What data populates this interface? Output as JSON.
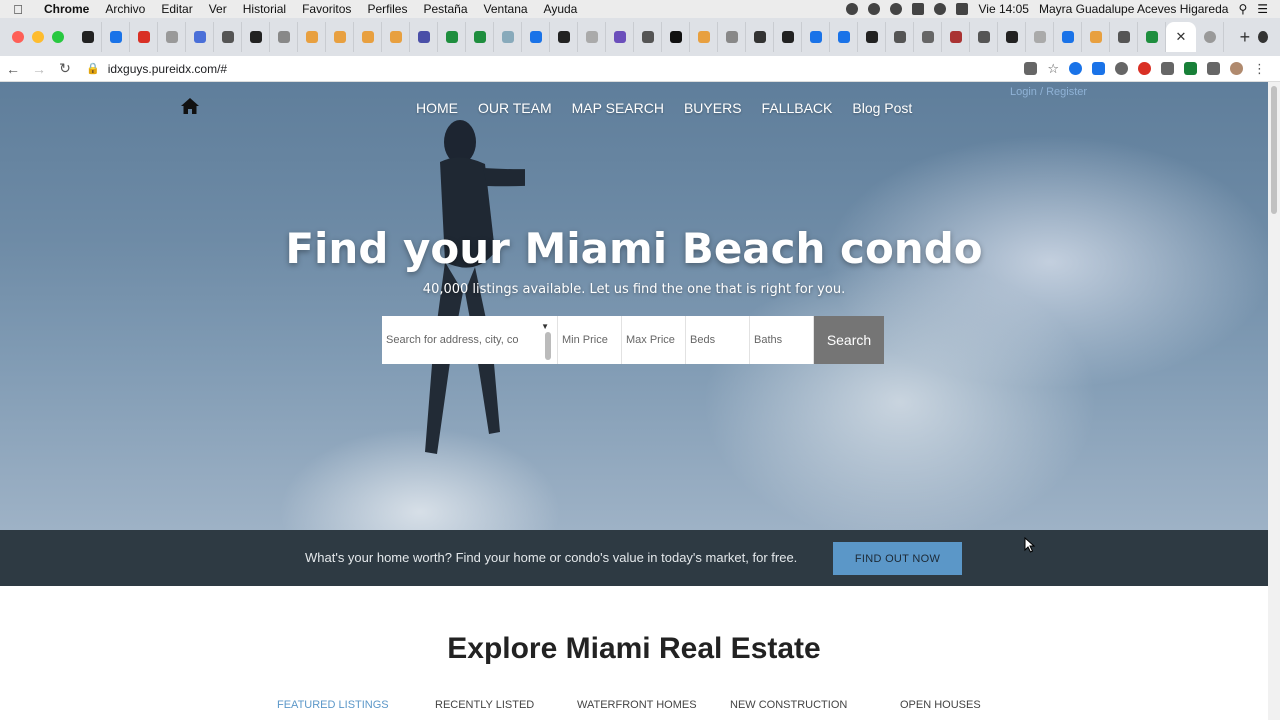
{
  "menubar": {
    "app": "Chrome",
    "items": [
      "Archivo",
      "Editar",
      "Ver",
      "Historial",
      "Favoritos",
      "Perfiles",
      "Pestaña",
      "Ventana",
      "Ayuda"
    ],
    "clock": "Vie 14:05",
    "user": "Mayra Guadalupe Aceves Higareda"
  },
  "toolbar": {
    "url": "idxguys.pureidx.com/#"
  },
  "nav": {
    "links": [
      "HOME",
      "OUR TEAM",
      "MAP SEARCH",
      "BUYERS",
      "FALLBACK",
      "Blog Post"
    ],
    "login": "Login / Register"
  },
  "hero": {
    "title": "Find your Miami Beach condo",
    "subtitle": "40,000 listings available. Let us find the one that is right for you."
  },
  "search": {
    "address_placeholder": "Search for address, city, co",
    "min_price_placeholder": "Min Price",
    "max_price_placeholder": "Max Price",
    "beds_placeholder": "Beds",
    "baths_placeholder": "Baths",
    "button": "Search"
  },
  "cta": {
    "text": "What's your home worth? Find your home or condo's value in today's market, for free.",
    "button": "FIND OUT NOW"
  },
  "explore": {
    "title": "Explore Miami Real Estate",
    "tabs": [
      "FEATURED LISTINGS",
      "RECENTLY LISTED",
      "WATERFRONT HOMES",
      "NEW CONSTRUCTION",
      "OPEN HOUSES"
    ],
    "active_tab": "FEATURED LISTINGS"
  },
  "colors": {
    "accent": "#5b97c8",
    "cta_band": "#2e3a43",
    "search_button": "#757575"
  }
}
